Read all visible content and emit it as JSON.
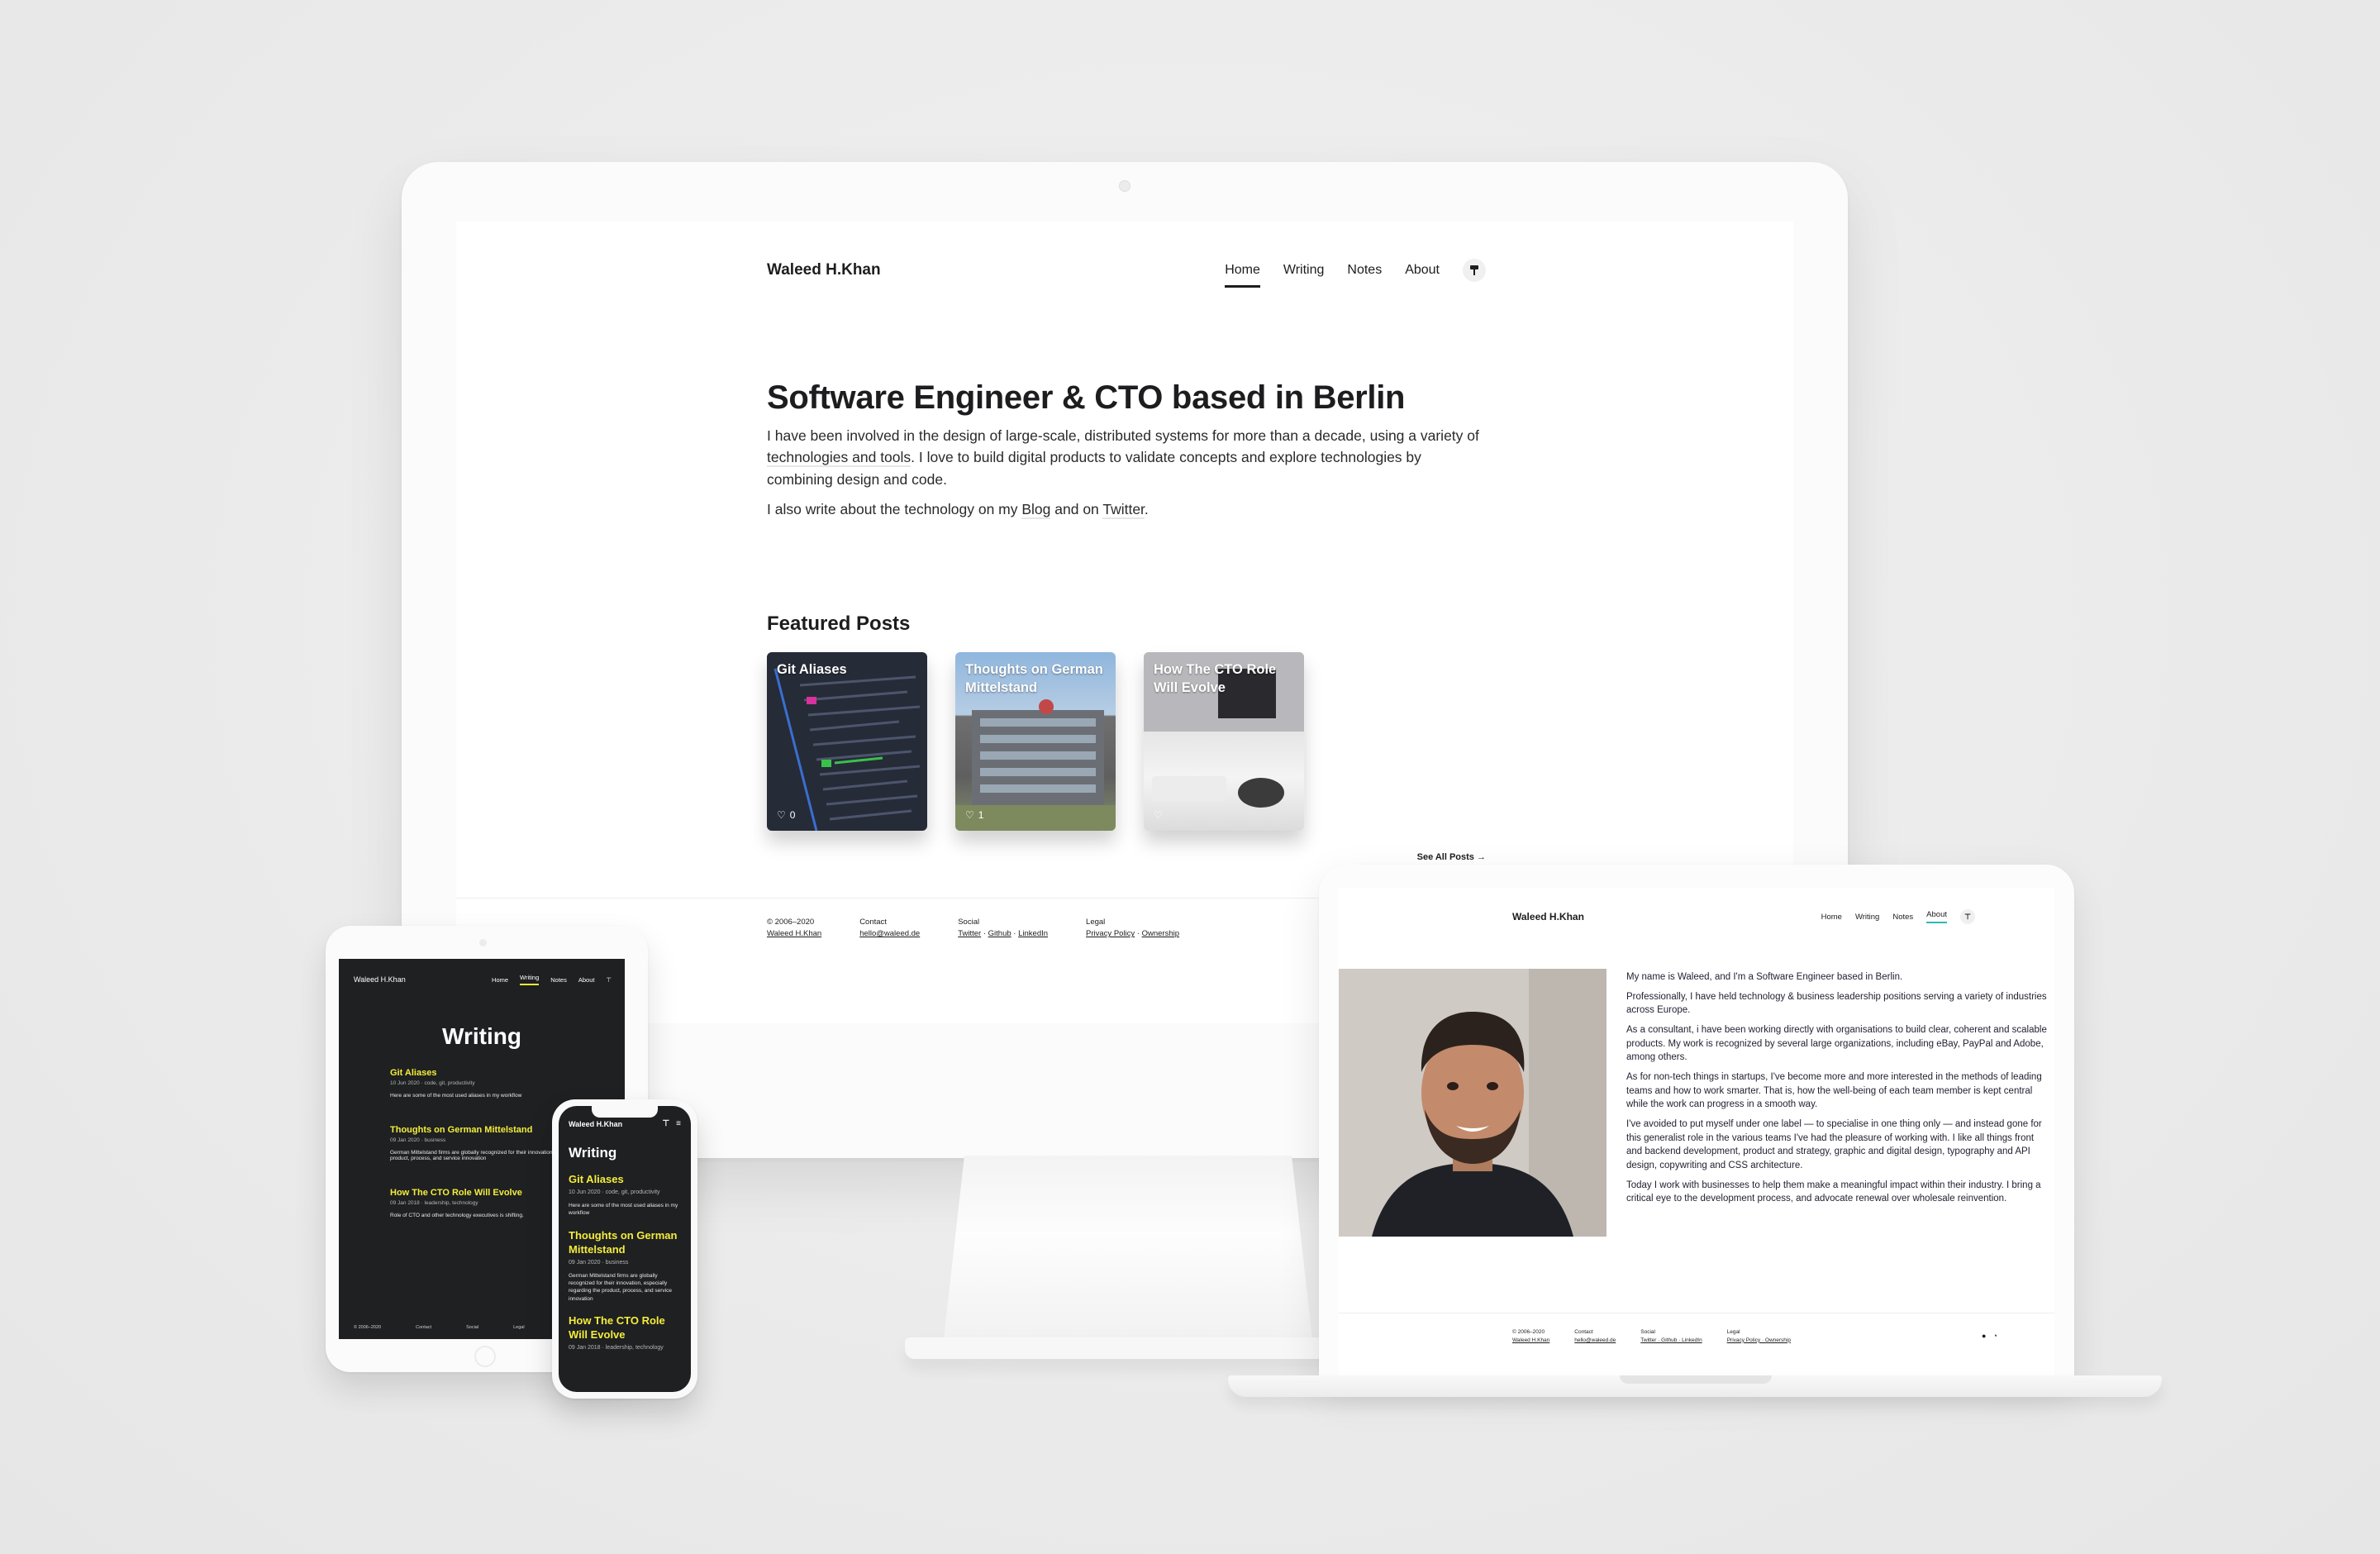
{
  "desktop": {
    "brand": "Waleed H.Khan",
    "nav": [
      "Home",
      "Writing",
      "Notes",
      "About"
    ],
    "theme_icon": "paint-roller-icon",
    "hero_title": "Software Engineer & CTO based in Berlin",
    "hero_p1_a": "I have been involved in the design of large-scale, distributed systems for more than a decade, using a variety of ",
    "hero_p1_link": "technologies and tools",
    "hero_p1_b": ". I love to build digital products to validate concepts and explore technologies by combining design and code.",
    "hero_p2_a": "I also write about the technology on my ",
    "hero_p2_blog": "Blog",
    "hero_p2_mid": " and on ",
    "hero_p2_twitter": "Twitter",
    "hero_p2_end": ".",
    "featured_title": "Featured Posts",
    "cards": [
      {
        "title": "Git Aliases",
        "likes": "0"
      },
      {
        "title": "Thoughts on German Mittelstand",
        "likes": "1"
      },
      {
        "title": "How The CTO Role Will Evolve",
        "likes": ""
      }
    ],
    "see_all": "See All Posts",
    "footer": {
      "copy": "© 2006–2020",
      "copy_name": "Waleed H.Khan",
      "contact_label": "Contact",
      "contact_email": "hello@waleed.de",
      "social_label": "Social",
      "social_twitter": "Twitter",
      "social_github": "Github",
      "social_linkedin": "LinkedIn",
      "legal_label": "Legal",
      "legal_privacy": "Privacy Policy",
      "legal_ownership": "Ownership",
      "sep": "·"
    }
  },
  "tablet": {
    "brand": "Waleed H.Khan",
    "nav": [
      "Home",
      "Writing",
      "Notes",
      "About"
    ],
    "title": "Writing",
    "items": [
      {
        "title": "Git Aliases",
        "meta": "10 Jun 2020 · code, git, productivity",
        "excerpt": "Here are some of the most used aliases in my workflow"
      },
      {
        "title": "Thoughts on German Mittelstand",
        "meta": "09 Jan 2020 · business",
        "excerpt": "German Mittelstand firms are globally recognized for their innovation, especially regarding the product, process, and service innovation"
      },
      {
        "title": "How The CTO Role Will Evolve",
        "meta": "09 Jan 2018 · leadership, technology",
        "excerpt": "Role of CTO and other technology executives is shifting."
      }
    ],
    "footer": [
      "© 2006–2020",
      "Contact",
      "Social",
      "Legal"
    ]
  },
  "phone": {
    "brand": "Waleed H.Khan",
    "title": "Writing",
    "items": [
      {
        "title": "Git Aliases",
        "meta": "10 Jun 2020 · code, git, productivity",
        "excerpt": "Here are some of the most used aliases in my workflow"
      },
      {
        "title": "Thoughts on German Mittelstand",
        "meta": "09 Jan 2020 · business",
        "excerpt": "German Mittelstand firms are globally recognized for their innovation, especially regarding the product, process, and service innovation"
      },
      {
        "title": "How The CTO Role Will Evolve",
        "meta": "09 Jan 2018 · leadership, technology",
        "excerpt": ""
      }
    ]
  },
  "laptop": {
    "brand": "Waleed H.Khan",
    "nav": [
      "Home",
      "Writing",
      "Notes",
      "About"
    ],
    "about": [
      "My name is Waleed, and I'm a Software Engineer based in Berlin.",
      "Professionally, I have held technology & business leadership positions serving a variety of industries across Europe.",
      "As a consultant, i have been working directly with organisations to build clear, coherent and scalable products. My work is recognized by several large organizations, including eBay, PayPal and Adobe, among others.",
      "As for non-tech things in startups, I've become more and more interested in the methods of leading teams and how to work smarter. That is, how the well-being of each team member is kept central while the work can progress in a smooth way.",
      "I've avoided to put myself under one label — to specialise in one thing only — and instead gone for this generalist role in the various teams I've had the pleasure of working with. I like all things front and backend development, product and strategy, graphic and digital design, typography and API design, copywriting and CSS architecture.",
      "Today I work with businesses to help them make a meaningful impact within their industry. I bring a critical eye to the development process, and advocate renewal over wholesale reinvention."
    ],
    "footer": {
      "copy": "© 2006–2020",
      "copy_name": "Waleed H.Khan",
      "contact_label": "Contact",
      "contact_email": "hello@waleed.de",
      "social_label": "Social",
      "social_links": "Twitter · Github · LinkedIn",
      "legal_label": "Legal",
      "legal_links": "Privacy Policy · Ownership"
    },
    "footer_icons": [
      "github-icon",
      "rss-icon"
    ]
  },
  "colors": {
    "accent_yellow": "#f5ed3a",
    "accent_teal": "#2fb8b8",
    "dark_bg": "#1e2022",
    "text": "#1d1d1f"
  }
}
